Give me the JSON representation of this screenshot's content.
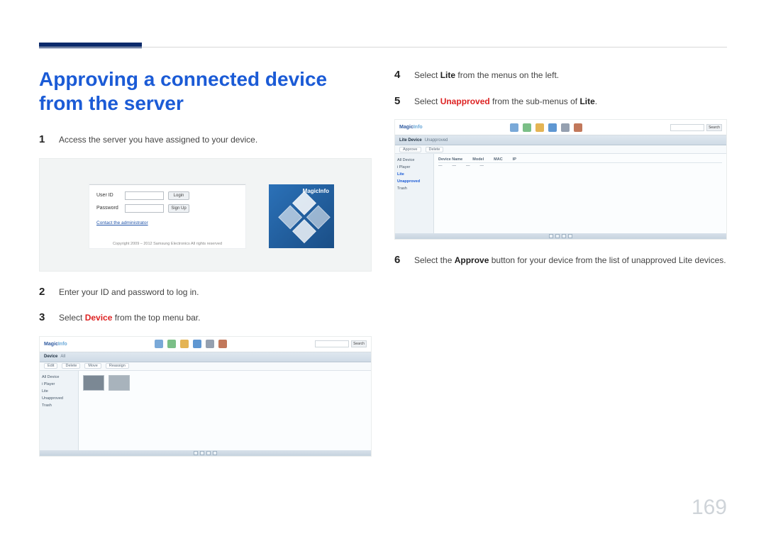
{
  "section_title": "Approving a connected device from the server",
  "page_number": "169",
  "left_steps": [
    {
      "num": "1",
      "text": "Access the server you have assigned to your device."
    },
    {
      "num": "2",
      "text": "Enter your ID and password to log in."
    },
    {
      "num": "3",
      "prefix": "Select ",
      "highlight": "Device",
      "suffix": " from the top menu bar."
    }
  ],
  "right_steps": [
    {
      "num": "4",
      "prefix": "Select ",
      "bold": "Lite",
      "suffix": " from the menus on the left."
    },
    {
      "num": "5",
      "prefix": "Select ",
      "highlight": "Unapproved",
      "suffix_before_bold": " from the sub-menus of ",
      "bold": "Lite",
      "suffix": "."
    },
    {
      "num": "6",
      "prefix": "Select the ",
      "bold": "Approve",
      "suffix": " button for your device from the list of unapproved Lite devices."
    }
  ],
  "login": {
    "user_label": "User ID",
    "pass_label": "Password",
    "login_btn": "Login",
    "signup_btn": "Sign Up",
    "admin_link": "Contact the administrator",
    "copyright": "Copyright 2009 – 2012 Samsung Electronics All rights reserved",
    "brand": "MagicInfo"
  },
  "app": {
    "brand_a": "Magic",
    "brand_b": "Info",
    "search_btn": "Search",
    "device_crumb": "Device",
    "all_crumb": "All",
    "lite_crumb": "Lite Device",
    "unapproved_crumb": "Unapproved",
    "side": {
      "all_device": "All Device",
      "i_player": "i Player",
      "lite": "Lite",
      "unapproved": "Unapproved",
      "error": "Trash"
    },
    "subbar": [
      "Edit",
      "Delete",
      "Move",
      "Reassign"
    ],
    "headers": [
      "Device Name",
      "Model",
      "MAC",
      "IP"
    ],
    "approve_btn": "Approve"
  }
}
